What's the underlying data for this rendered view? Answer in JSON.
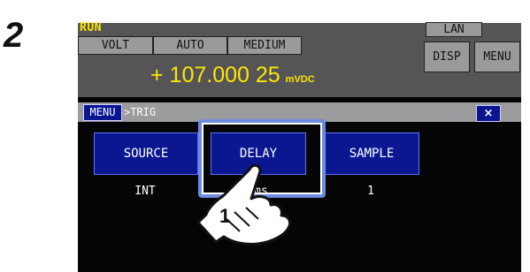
{
  "step": {
    "number": "2"
  },
  "status": {
    "run_label": "RUN",
    "function": "VOLT",
    "range": "AUTO",
    "speed": "MEDIUM",
    "lan_label": "LAN",
    "disp_label": "DISP",
    "menu_label": "MENU",
    "reading_value": "+ 107.000 25",
    "reading_unit": "mVDC"
  },
  "menu_bar": {
    "tag": "MENU",
    "path": ">TRIG",
    "close_symbol": "×"
  },
  "settings": [
    {
      "label": "SOURCE",
      "value": "INT"
    },
    {
      "label": "DELAY",
      "value": "0ms"
    },
    {
      "label": "SAMPLE",
      "value": "1"
    }
  ],
  "callout": {
    "step": "1"
  },
  "colors": {
    "reading": "#ffe600",
    "tile": "#0b1790",
    "highlight": "#6d8ce0",
    "panel": "#555557",
    "bar": "#9c9c9e"
  }
}
